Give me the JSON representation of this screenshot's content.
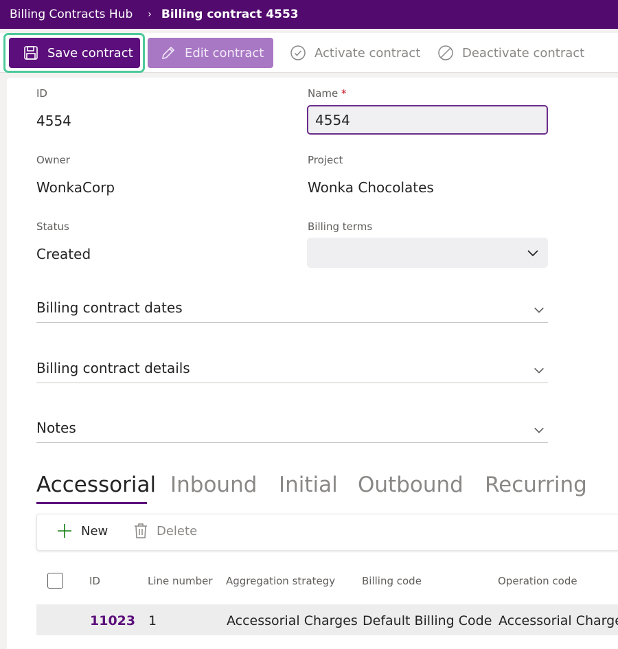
{
  "breadcrumb": {
    "app": "Billing Contracts Hub",
    "current": "Billing contract 4553"
  },
  "toolbar": {
    "save_label": "Save contract",
    "edit_label": "Edit contract",
    "activate_label": "Activate contract",
    "deactivate_label": "Deactivate contract"
  },
  "form": {
    "id_label": "ID",
    "id_value": "4554",
    "name_label": "Name",
    "name_required": "*",
    "name_value": "4554",
    "owner_label": "Owner",
    "owner_value": "WonkaCorp",
    "project_label": "Project",
    "project_value": "Wonka Chocolates",
    "status_label": "Status",
    "status_value": "Created",
    "billing_terms_label": "Billing terms",
    "billing_terms_value": ""
  },
  "sections": [
    "Billing contract dates",
    "Billing contract details",
    "Notes"
  ],
  "tabs": [
    "Accessorial",
    "Inbound",
    "Initial",
    "Outbound",
    "Recurring"
  ],
  "active_tab": "Accessorial",
  "grid": {
    "new_label": "New",
    "delete_label": "Delete",
    "columns": [
      "ID",
      "Line number",
      "Aggregation strategy",
      "Billing code",
      "Operation code"
    ],
    "rows": [
      [
        "11023",
        "1",
        "Accessorial Charges",
        "Default Billing Code",
        "Accessorial Charge"
      ]
    ]
  },
  "colors": {
    "brand": "#520a6e",
    "primary_button": "#5c0f7c",
    "focus_ring": "#4dc99a",
    "add_icon": "#107c10"
  },
  "icons": {
    "save": "save-icon",
    "edit": "pencil-icon",
    "activate": "check-circle-icon",
    "deactivate": "block-icon",
    "chevron": "chevron-down-icon",
    "add": "plus-icon",
    "delete": "trash-icon"
  }
}
